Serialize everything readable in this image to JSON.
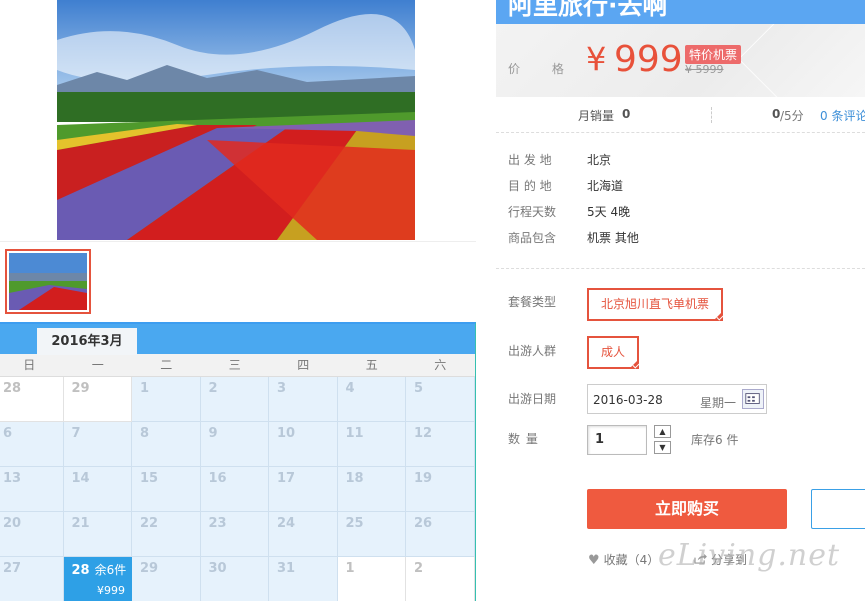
{
  "product": {
    "title": "阿里旅行·去啊",
    "price_label": "价 格",
    "currency": "¥",
    "price": "999",
    "price_tag": "特价机票",
    "original_price": "¥ 5999",
    "sales_label": "月销量",
    "sales_value": "0",
    "score_value": "0",
    "score_unit": "/5分",
    "review_link": "0 条评论"
  },
  "info": [
    {
      "key": "出 发 地",
      "value": "北京"
    },
    {
      "key": "目 的 地",
      "value": "北海道"
    },
    {
      "key": "行程天数",
      "value": "5天 4晚"
    },
    {
      "key": "商品包含",
      "value": "机票 其他"
    }
  ],
  "options": {
    "package_label": "套餐类型",
    "package_value": "北京旭川直飞单机票",
    "group_label": "出游人群",
    "group_value": "成人",
    "date_label": "出游日期",
    "date_value": "2016-03-28",
    "date_weekday": "星期一",
    "qty_label": "数 量",
    "qty_value": "1",
    "stock": "库存6 件"
  },
  "actions": {
    "buy": "立即购买",
    "favorite": "收藏（4）",
    "share": "分享到"
  },
  "calendar": {
    "month": "2016年3月",
    "weekdays": [
      "日",
      "一",
      "二",
      "三",
      "四",
      "五",
      "六"
    ],
    "days": [
      {
        "d": "28",
        "state": "empty"
      },
      {
        "d": "29",
        "state": "empty"
      },
      {
        "d": "1",
        "state": "normal"
      },
      {
        "d": "2",
        "state": "normal"
      },
      {
        "d": "3",
        "state": "normal"
      },
      {
        "d": "4",
        "state": "normal"
      },
      {
        "d": "5",
        "state": "normal"
      },
      {
        "d": "6",
        "state": "normal"
      },
      {
        "d": "7",
        "state": "normal"
      },
      {
        "d": "8",
        "state": "normal"
      },
      {
        "d": "9",
        "state": "normal"
      },
      {
        "d": "10",
        "state": "normal"
      },
      {
        "d": "11",
        "state": "normal"
      },
      {
        "d": "12",
        "state": "normal"
      },
      {
        "d": "13",
        "state": "normal"
      },
      {
        "d": "14",
        "state": "normal"
      },
      {
        "d": "15",
        "state": "normal"
      },
      {
        "d": "16",
        "state": "normal"
      },
      {
        "d": "17",
        "state": "normal"
      },
      {
        "d": "18",
        "state": "normal"
      },
      {
        "d": "19",
        "state": "normal"
      },
      {
        "d": "20",
        "state": "normal"
      },
      {
        "d": "21",
        "state": "normal"
      },
      {
        "d": "22",
        "state": "normal"
      },
      {
        "d": "23",
        "state": "normal"
      },
      {
        "d": "24",
        "state": "normal"
      },
      {
        "d": "25",
        "state": "normal"
      },
      {
        "d": "26",
        "state": "normal"
      },
      {
        "d": "27",
        "state": "normal"
      },
      {
        "d": "28",
        "state": "selected",
        "stock": "余6件",
        "price": "¥999"
      },
      {
        "d": "29",
        "state": "normal"
      },
      {
        "d": "30",
        "state": "normal"
      },
      {
        "d": "31",
        "state": "normal"
      },
      {
        "d": "1",
        "state": "empty"
      },
      {
        "d": "2",
        "state": "empty"
      }
    ]
  },
  "watermark": "eLiving.net",
  "colors": {
    "accent_red": "#e5533d",
    "buy_button": "#ef5a3f",
    "calendar_blue": "#4aa8f0",
    "selected_day": "#2ea0e6",
    "link_blue": "#3d8fd8"
  }
}
